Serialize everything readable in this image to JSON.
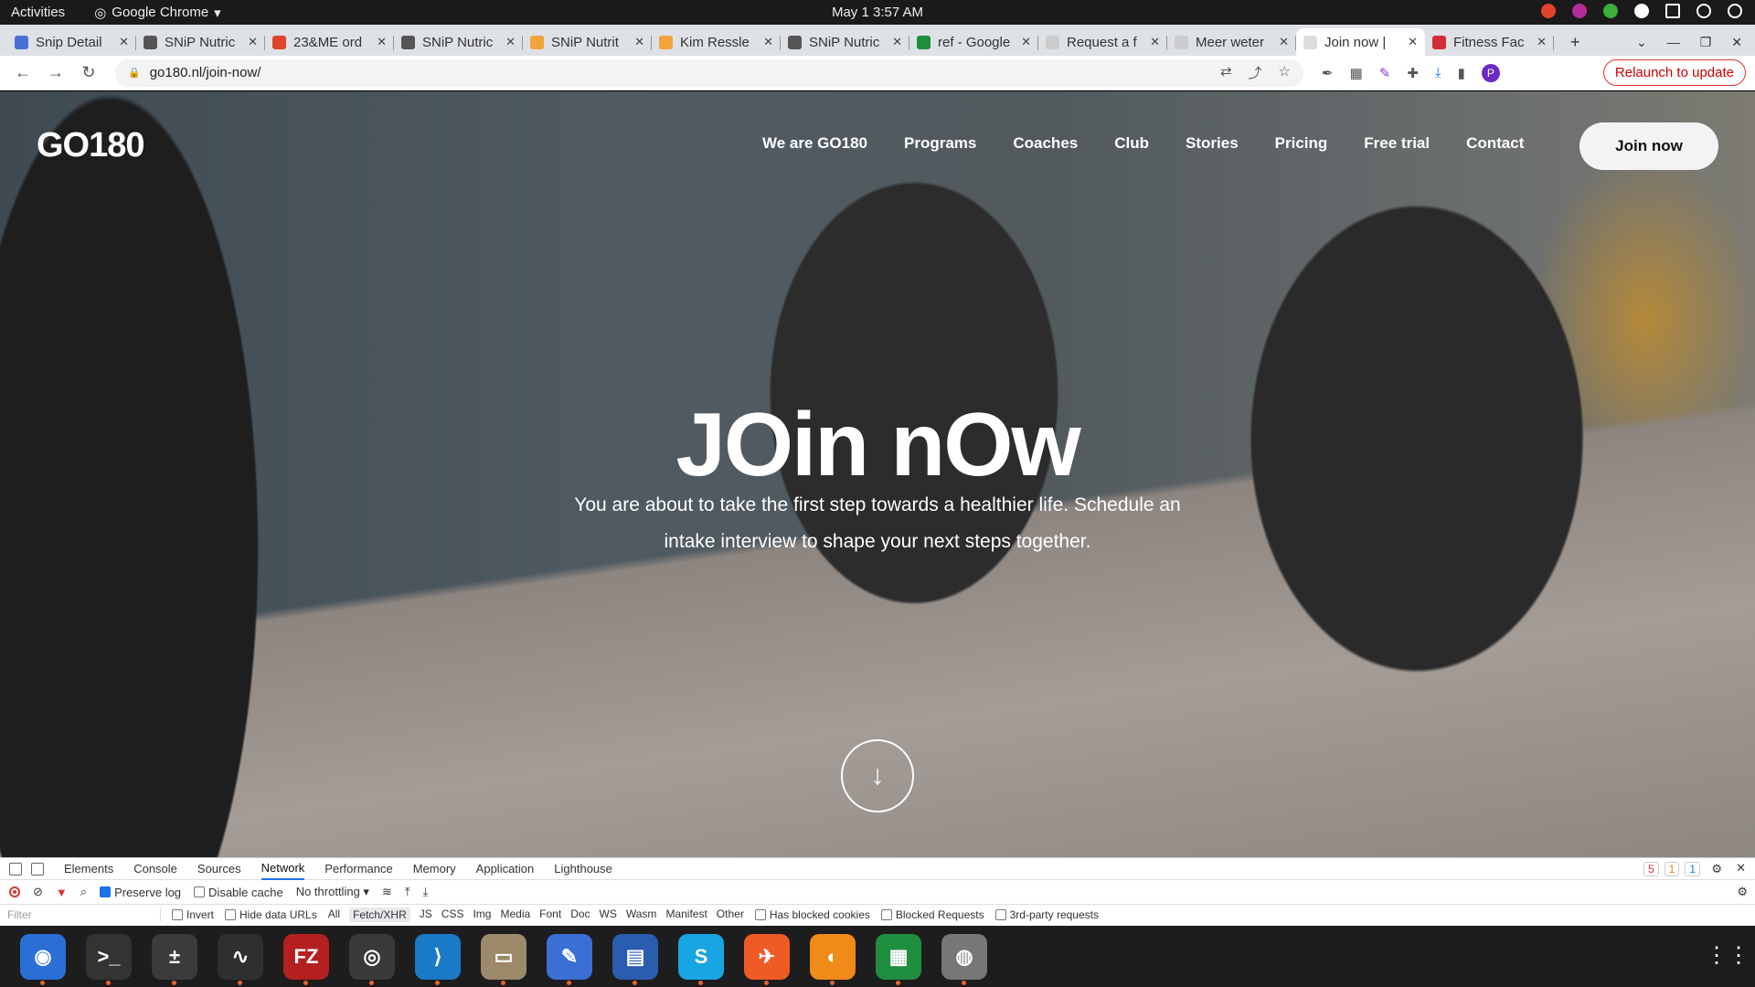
{
  "system": {
    "activities": "Activities",
    "app_menu": "Google Chrome",
    "clock": "May 1  3:57 AM"
  },
  "tabs": [
    {
      "title": "Snip Detail",
      "fav_color": "#4a6fd8"
    },
    {
      "title": "SNiP Nutric",
      "fav_color": "#555555"
    },
    {
      "title": "23&ME ord",
      "fav_color": "#e0442a"
    },
    {
      "title": "SNiP Nutric",
      "fav_color": "#555555"
    },
    {
      "title": "SNiP Nutrit",
      "fav_color": "#f2a33a"
    },
    {
      "title": "Kim Ressle",
      "fav_color": "#f2a33a"
    },
    {
      "title": "SNiP Nutric",
      "fav_color": "#555555"
    },
    {
      "title": "ref - Google",
      "fav_color": "#1e8e3e"
    },
    {
      "title": "Request a f",
      "fav_color": "#cccccc"
    },
    {
      "title": "Meer weter",
      "fav_color": "#cccccc"
    },
    {
      "title": "Join now |",
      "fav_color": "#dddddd"
    },
    {
      "title": "Fitness Fac",
      "fav_color": "#d22d3a"
    }
  ],
  "active_tab_index": 10,
  "address_bar": {
    "url": "go180.nl/join-now/",
    "relaunch_label": "Relaunch to update"
  },
  "site": {
    "logo": "GO180",
    "nav": [
      "We are GO180",
      "Programs",
      "Coaches",
      "Club",
      "Stories",
      "Pricing",
      "Free trial",
      "Contact"
    ],
    "join_button": "Join now",
    "hero_title": "JOin nOw",
    "hero_subtitle": "You are about to take the first step towards a healthier life. Schedule an intake interview to shape your next steps together.",
    "scroll_icon": "↓"
  },
  "devtools": {
    "panels": [
      "Elements",
      "Console",
      "Sources",
      "Network",
      "Performance",
      "Memory",
      "Application",
      "Lighthouse"
    ],
    "active_panel": "Network",
    "errors": "5",
    "warnings": "1",
    "messages": "1",
    "preserve_log": "Preserve log",
    "disable_cache": "Disable cache",
    "throttling": "No throttling",
    "filter_placeholder": "Filter",
    "invert": "Invert",
    "hide_data_urls": "Hide data URLs",
    "type_filters": [
      "All",
      "Fetch/XHR",
      "JS",
      "CSS",
      "Img",
      "Media",
      "Font",
      "Doc",
      "WS",
      "Wasm",
      "Manifest",
      "Other"
    ],
    "active_type_filter": "Fetch/XHR",
    "has_blocked_cookies": "Has blocked cookies",
    "blocked_requests": "Blocked Requests",
    "third_party": "3rd-party requests"
  },
  "dock": [
    {
      "name": "thunderbird",
      "color": "#2a6fd6",
      "glyph": "◉"
    },
    {
      "name": "terminal",
      "color": "#333333",
      "glyph": ">_"
    },
    {
      "name": "calculator",
      "color": "#3b3b3b",
      "glyph": "±"
    },
    {
      "name": "system-monitor",
      "color": "#2f2f2f",
      "glyph": "∿"
    },
    {
      "name": "filezilla",
      "color": "#b41f1f",
      "glyph": "FZ"
    },
    {
      "name": "chrome",
      "color": "#3a3a3a",
      "glyph": "◎"
    },
    {
      "name": "vscode",
      "color": "#1b7ac8",
      "glyph": "⟩"
    },
    {
      "name": "files",
      "color": "#9c8a6a",
      "glyph": "▭"
    },
    {
      "name": "text-editor",
      "color": "#3b6fd6",
      "glyph": "✎"
    },
    {
      "name": "document-viewer",
      "color": "#2a5db0",
      "glyph": "▤"
    },
    {
      "name": "skype",
      "color": "#17a5e3",
      "glyph": "S"
    },
    {
      "name": "postman",
      "color": "#ef5b25",
      "glyph": "✈"
    },
    {
      "name": "firefox-dev",
      "color": "#f08a19",
      "glyph": "◐"
    },
    {
      "name": "spreadsheet",
      "color": "#1e8e3e",
      "glyph": "▦"
    },
    {
      "name": "disks",
      "color": "#777777",
      "glyph": "◍"
    }
  ]
}
